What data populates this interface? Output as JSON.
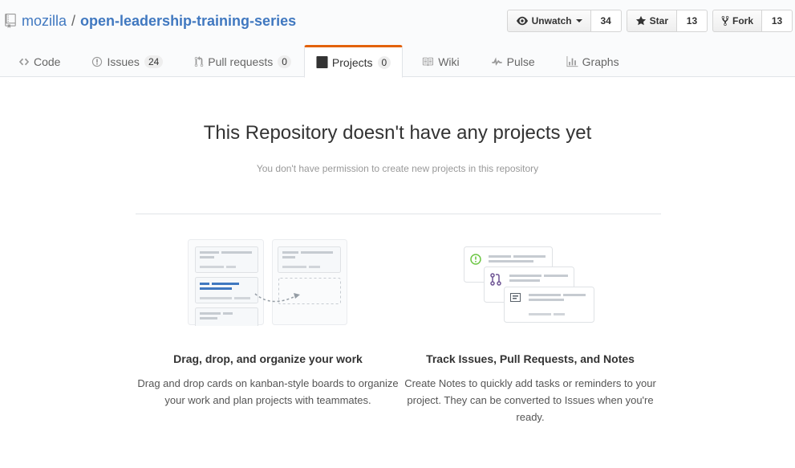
{
  "repo": {
    "owner": "mozilla",
    "separator": "/",
    "name": "open-leadership-training-series"
  },
  "actions": {
    "watch": {
      "label": "Unwatch",
      "count": "34"
    },
    "star": {
      "label": "Star",
      "count": "13"
    },
    "fork": {
      "label": "Fork",
      "count": "13"
    }
  },
  "tabs": [
    {
      "label": "Code",
      "icon": "code-icon"
    },
    {
      "label": "Issues",
      "icon": "issue-icon",
      "counter": "24"
    },
    {
      "label": "Pull requests",
      "icon": "pull-request-icon",
      "counter": "0"
    },
    {
      "label": "Projects",
      "icon": "project-icon",
      "counter": "0",
      "selected": true
    },
    {
      "label": "Wiki",
      "icon": "book-icon"
    },
    {
      "label": "Pulse",
      "icon": "pulse-icon"
    },
    {
      "label": "Graphs",
      "icon": "graph-icon"
    }
  ],
  "blank": {
    "title": "This Repository doesn't have any projects yet",
    "subtitle": "You don't have permission to create new projects in this repository"
  },
  "features": [
    {
      "title": "Drag, drop, and organize your work",
      "text": "Drag and drop cards on kanban-style boards to organize your work and plan projects with teammates."
    },
    {
      "title": "Track Issues, Pull Requests, and Notes",
      "text": "Create Notes to quickly add tasks or reminders to your project. They can be converted to Issues when you're ready."
    }
  ],
  "colors": {
    "link": "#4078c0",
    "tab_accent": "#e36209",
    "issue_green": "#6cc644",
    "pr_purple": "#6e5494"
  }
}
